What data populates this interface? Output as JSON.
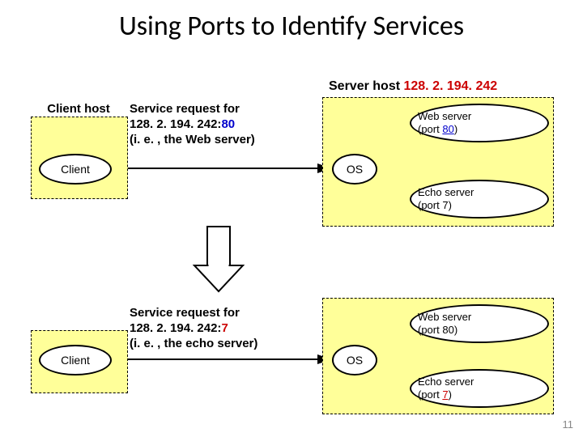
{
  "title": "Using Ports to Identify Services",
  "server_host_label_prefix": "Server host ",
  "server_host_ip": "128. 2. 194. 242",
  "client_host_label": "Client host",
  "client_label": "Client",
  "os_label": "OS",
  "request1": {
    "line1": "Service request for",
    "ip": "128. 2. 194. 242:",
    "port": "80",
    "line3": "(i. e. , the Web server)"
  },
  "request2": {
    "line1": "Service request for",
    "ip": "128. 2. 194. 242:",
    "port": "7",
    "line3": "(i. e. , the echo server)"
  },
  "web_server_label": "Web server",
  "web_server_port_prefix": "(port ",
  "web_server_port": "80",
  "web_server_port_suffix": ")",
  "echo_server_label": "Echo server",
  "echo_server_port_prefix": "(port ",
  "echo_server_port": "7",
  "echo_server_port_suffix": ")",
  "page_number": "11"
}
